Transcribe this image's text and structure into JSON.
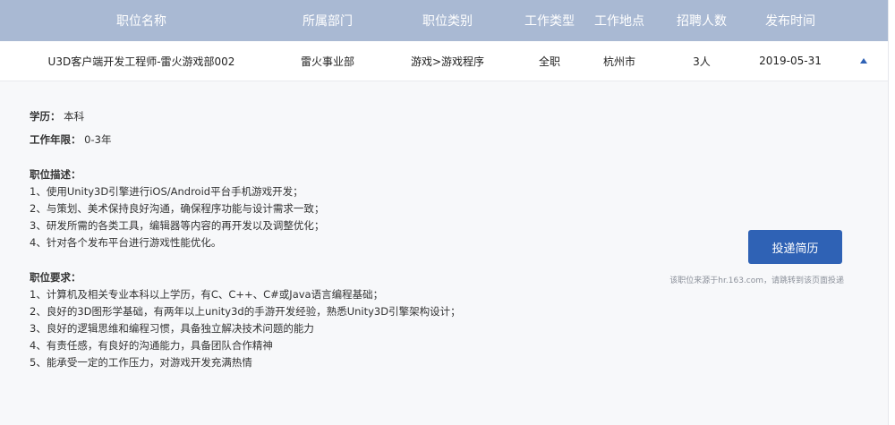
{
  "table": {
    "headers": [
      "职位名称",
      "所属部门",
      "职位类别",
      "工作类型",
      "工作地点",
      "招聘人数",
      "发布时间"
    ],
    "row": {
      "title": "U3D客户端开发工程师-雷火游戏部002",
      "department": "雷火事业部",
      "category": "游戏>游戏程序",
      "type": "全职",
      "location": "杭州市",
      "headcount": "3人",
      "date": "2019-05-31",
      "toggle_icon": "caret-up-icon"
    }
  },
  "detail": {
    "education_label": "学历：",
    "education_value": "本科",
    "experience_label": "工作年限：",
    "experience_value": "0-3年",
    "description_title": "职位描述：",
    "description": [
      "1、使用Unity3D引擎进行iOS/Android平台手机游戏开发；",
      "2、与策划、美术保持良好沟通，确保程序功能与设计需求一致；",
      "3、研发所需的各类工具，编辑器等内容的再开发以及调整优化；",
      "4、针对各个发布平台进行游戏性能优化。"
    ],
    "requirements_title": "职位要求：",
    "requirements": [
      "1、计算机及相关专业本科以上学历，有C、C++、C#或Java语言编程基础；",
      "2、良好的3D图形学基础，有两年以上unity3d的手游开发经验，熟悉Unity3D引擎架构设计；",
      "3、良好的逻辑思维和编程习惯，具备独立解决技术问题的能力",
      "4、有责任感，有良好的沟通能力，具备团队合作精神",
      "5、能承受一定的工作压力，对游戏开发充满热情"
    ],
    "apply_label": "投递简历",
    "source_note": "该职位来源于hr.163.com，请跳转到该页面投递"
  },
  "colors": {
    "header_bg": "#a9b9d3",
    "accent": "#2f62b5",
    "panel_bg": "#f7f8fa"
  }
}
